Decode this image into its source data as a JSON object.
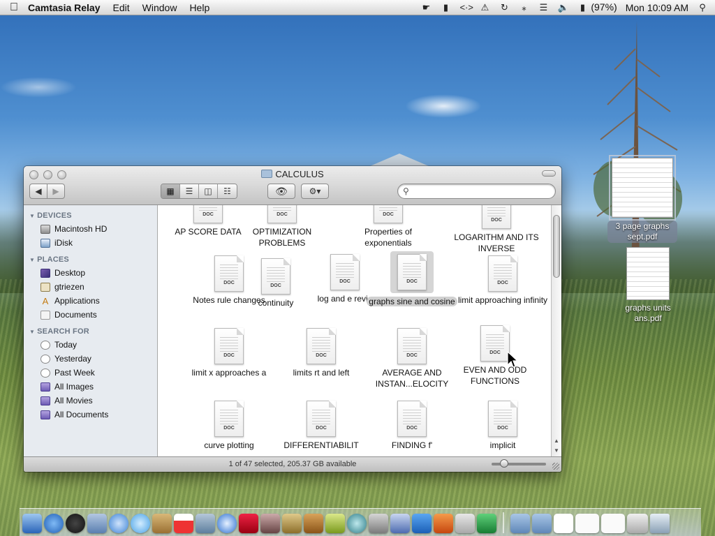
{
  "menubar": {
    "app_name": "Camtasia Relay",
    "menus": [
      "Edit",
      "Window",
      "Help"
    ],
    "battery": "(97%)",
    "clock": "Mon 10:09 AM"
  },
  "window": {
    "title": "CALCULUS",
    "status": "1 of 47 selected, 205.37 GB available",
    "search_placeholder": ""
  },
  "sidebar": {
    "devices_header": "DEVICES",
    "devices": [
      "Macintosh HD",
      "iDisk"
    ],
    "places_header": "PLACES",
    "places": [
      "Desktop",
      "gtriezen",
      "Applications",
      "Documents"
    ],
    "search_header": "SEARCH FOR",
    "search_for": [
      "Today",
      "Yesterday",
      "Past Week",
      "All Images",
      "All Movies",
      "All Documents"
    ]
  },
  "files": [
    {
      "name": "AP SCORE DATA",
      "tag": "DOC"
    },
    {
      "name": "OPTIMIZATION PROBLEMS",
      "tag": "DOC"
    },
    {
      "name": "Properties of exponentials",
      "tag": "DOC"
    },
    {
      "name": "LOGARITHM AND ITS INVERSE",
      "tag": "DOC"
    },
    {
      "name": "Notes rule changes",
      "tag": "DOC"
    },
    {
      "name": "continuity",
      "tag": "DOC"
    },
    {
      "name": "log and e revie",
      "tag": "DOC"
    },
    {
      "name": "graphs sine and cosine",
      "tag": "DOC"
    },
    {
      "name": "limit approaching infinity",
      "tag": "DOC"
    },
    {
      "name": "limit x approaches a",
      "tag": "DOC"
    },
    {
      "name": "limits rt and left",
      "tag": "DOC"
    },
    {
      "name": "AVERAGE AND INSTAN...ELOCITY",
      "tag": "DOC"
    },
    {
      "name": "EVEN AND ODD FUNCTIONS",
      "tag": "DOC"
    },
    {
      "name": "curve plotting",
      "tag": "DOC"
    },
    {
      "name": "DIFFERENTIABILIT",
      "tag": "DOC"
    },
    {
      "name": "FINDING f'",
      "tag": "DOC"
    },
    {
      "name": "implicit",
      "tag": "DOC"
    }
  ],
  "desktop": {
    "icons": [
      "3 page graphs sept.pdf",
      "graphs units ans.pdf"
    ]
  },
  "colors": {
    "sidebar_bg": "#e7ebf0",
    "selection": "#d0d0d0"
  }
}
